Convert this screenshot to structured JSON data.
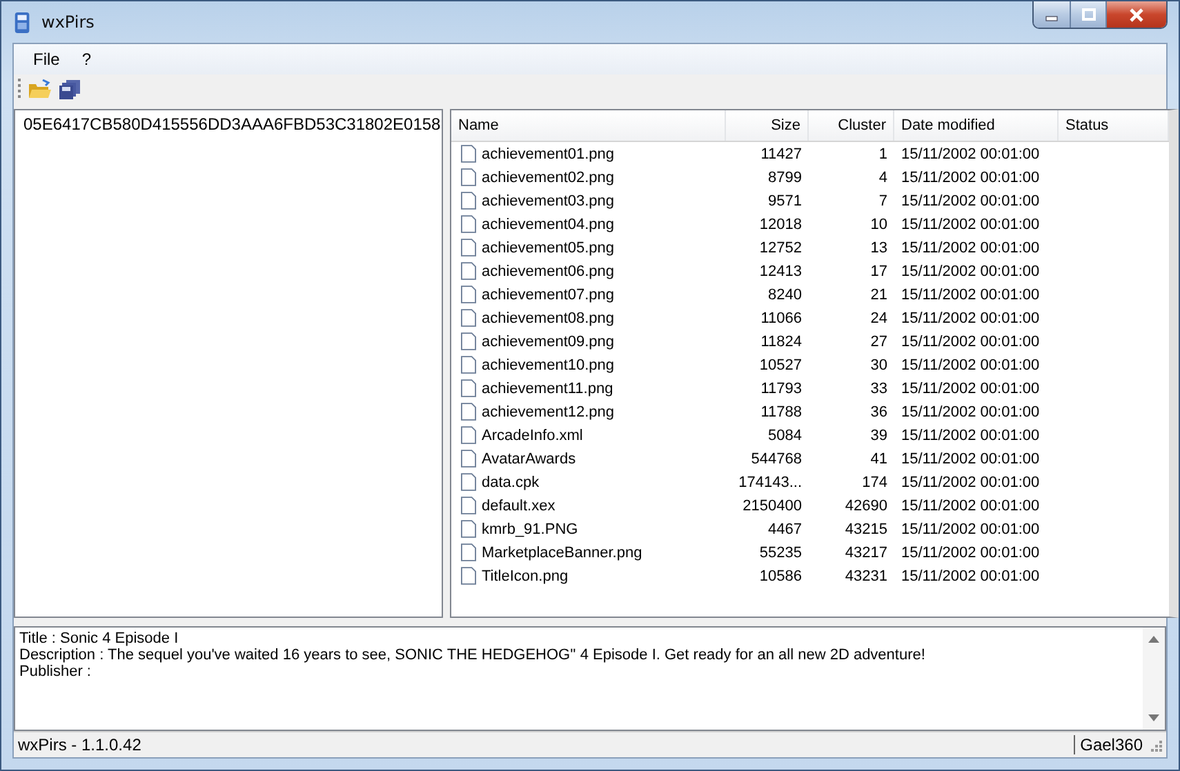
{
  "window": {
    "title": "wxPirs"
  },
  "menu": [
    "File",
    "?"
  ],
  "tree": {
    "root": "05E6417CB580D415556DD3AAA6FBD53C31802E0158"
  },
  "table": {
    "columns": [
      "Name",
      "Size",
      "Cluster",
      "Date modified",
      "Status"
    ],
    "rows": [
      {
        "name": "achievement01.png",
        "size": "11427",
        "cluster": "1",
        "date": "15/11/2002 00:01:00"
      },
      {
        "name": "achievement02.png",
        "size": "8799",
        "cluster": "4",
        "date": "15/11/2002 00:01:00"
      },
      {
        "name": "achievement03.png",
        "size": "9571",
        "cluster": "7",
        "date": "15/11/2002 00:01:00"
      },
      {
        "name": "achievement04.png",
        "size": "12018",
        "cluster": "10",
        "date": "15/11/2002 00:01:00"
      },
      {
        "name": "achievement05.png",
        "size": "12752",
        "cluster": "13",
        "date": "15/11/2002 00:01:00"
      },
      {
        "name": "achievement06.png",
        "size": "12413",
        "cluster": "17",
        "date": "15/11/2002 00:01:00"
      },
      {
        "name": "achievement07.png",
        "size": "8240",
        "cluster": "21",
        "date": "15/11/2002 00:01:00"
      },
      {
        "name": "achievement08.png",
        "size": "11066",
        "cluster": "24",
        "date": "15/11/2002 00:01:00"
      },
      {
        "name": "achievement09.png",
        "size": "11824",
        "cluster": "27",
        "date": "15/11/2002 00:01:00"
      },
      {
        "name": "achievement10.png",
        "size": "10527",
        "cluster": "30",
        "date": "15/11/2002 00:01:00"
      },
      {
        "name": "achievement11.png",
        "size": "11793",
        "cluster": "33",
        "date": "15/11/2002 00:01:00"
      },
      {
        "name": "achievement12.png",
        "size": "11788",
        "cluster": "36",
        "date": "15/11/2002 00:01:00"
      },
      {
        "name": "ArcadeInfo.xml",
        "size": "5084",
        "cluster": "39",
        "date": "15/11/2002 00:01:00"
      },
      {
        "name": "AvatarAwards",
        "size": "544768",
        "cluster": "41",
        "date": "15/11/2002 00:01:00"
      },
      {
        "name": "data.cpk",
        "size": "174143...",
        "cluster": "174",
        "date": "15/11/2002 00:01:00"
      },
      {
        "name": "default.xex",
        "size": "2150400",
        "cluster": "42690",
        "date": "15/11/2002 00:01:00"
      },
      {
        "name": "kmrb_91.PNG",
        "size": "4467",
        "cluster": "43215",
        "date": "15/11/2002 00:01:00"
      },
      {
        "name": "MarketplaceBanner.png",
        "size": "55235",
        "cluster": "43217",
        "date": "15/11/2002 00:01:00"
      },
      {
        "name": "TitleIcon.png",
        "size": "10586",
        "cluster": "43231",
        "date": "15/11/2002 00:01:00"
      }
    ]
  },
  "info": [
    "Title : Sonic 4 Episode I",
    "Description : The sequel you've waited 16 years to see, SONIC THE HEDGEHOG'' 4 Episode I.  Get ready for an all new 2D adventure!",
    "Publisher :"
  ],
  "status_bar": [
    "wxPirs - 1.1.0.42",
    "Gael360"
  ]
}
